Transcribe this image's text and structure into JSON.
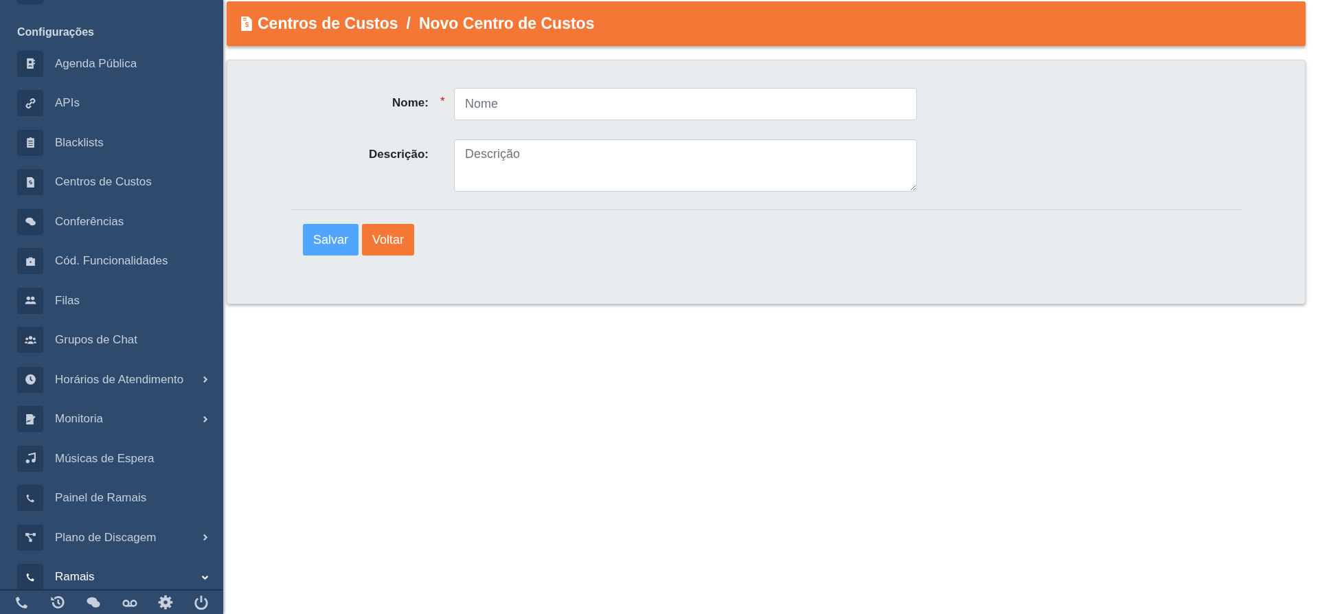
{
  "sidebar": {
    "section_title": "Configurações",
    "items": [
      {
        "label": "Agenda Pública",
        "selected": false
      },
      {
        "label": "APIs",
        "selected": false
      },
      {
        "label": "Blacklists",
        "selected": false
      },
      {
        "label": "Centros de Custos",
        "selected": false
      },
      {
        "label": "Conferências",
        "selected": false
      },
      {
        "label": "Cód. Funcionalidades",
        "selected": false
      },
      {
        "label": "Filas",
        "selected": false
      },
      {
        "label": "Grupos de Chat",
        "selected": false
      },
      {
        "label": "Horários de Atendimento",
        "selected": false,
        "expanded": false
      },
      {
        "label": "Monitoria",
        "selected": false,
        "expanded": false
      },
      {
        "label": "Músicas de Espera",
        "selected": false
      },
      {
        "label": "Painel de Ramais",
        "selected": false
      },
      {
        "label": "Plano de Discagem",
        "selected": false,
        "expanded": false
      },
      {
        "label": "Ramais",
        "selected": true,
        "expanded": true
      }
    ]
  },
  "header": {
    "breadcrumb": [
      "Centros de Custos",
      "Novo Centro de Custos"
    ],
    "separator": "/"
  },
  "form": {
    "fields": [
      {
        "kind": "input",
        "label": "Nome:",
        "required_mark": "*",
        "placeholder": "Nome"
      },
      {
        "kind": "textarea",
        "label": "Descrição:",
        "placeholder": "Descrição"
      }
    ],
    "buttons": [
      {
        "label": "Salvar",
        "kind": "primary"
      },
      {
        "label": "Voltar",
        "kind": "secondary"
      }
    ]
  }
}
